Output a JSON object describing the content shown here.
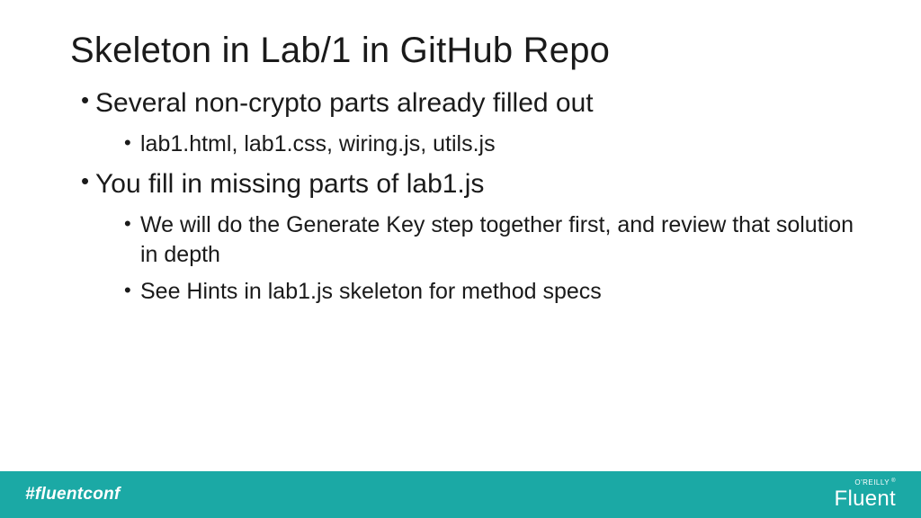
{
  "title": "Skeleton in Lab/1 in GitHub Repo",
  "bullets": [
    {
      "text": "Several non-crypto parts already filled out",
      "children": [
        {
          "text": "lab1.html, lab1.css, wiring.js, utils.js"
        }
      ]
    },
    {
      "text": "You fill in missing parts of lab1.js",
      "children": [
        {
          "text": "We will do the Generate Key step together first, and review that solution in depth"
        },
        {
          "text": "See Hints in lab1.js skeleton for method specs"
        }
      ]
    }
  ],
  "footer": {
    "hashtag": "#fluentconf",
    "brand_top": "O'REILLY",
    "brand_reg": "®",
    "brand_main": "Fluent"
  },
  "colors": {
    "footer_bg": "#1ba9a5",
    "text": "#1a1a1a",
    "footer_text": "#ffffff"
  }
}
